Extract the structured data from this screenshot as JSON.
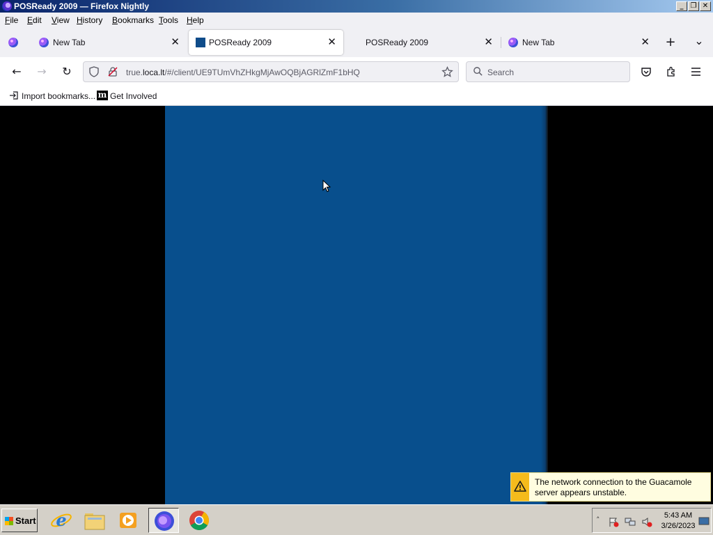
{
  "window": {
    "title": "POSReady 2009 — Firefox Nightly",
    "minimize_glyph": "_",
    "restore_glyph": "❐",
    "close_glyph": "✕"
  },
  "menu": [
    "File",
    "Edit",
    "View",
    "History",
    "Bookmarks",
    "Tools",
    "Help"
  ],
  "menu_mnemonics": [
    "F",
    "E",
    "V",
    "H",
    "B",
    "T",
    "H"
  ],
  "tabs": [
    {
      "label": "New Tab",
      "icon": "firefox-icon",
      "active": false
    },
    {
      "label": "POSReady 2009",
      "icon": "posready-favicon",
      "active": true
    },
    {
      "label": "POSReady 2009",
      "icon": "none",
      "active": false
    },
    {
      "label": "New Tab",
      "icon": "firefox-icon",
      "active": false
    }
  ],
  "tab_close_glyph": "✕",
  "toolbar": {
    "new_tab_glyph": "+",
    "tab_list_glyph": "⌄",
    "back_glyph": "←",
    "forward_glyph": "→",
    "reload_glyph": "↻"
  },
  "urlbar": {
    "prefix": "true.",
    "host": "loca.lt",
    "path": "/#/client/UE9TUmVhZHkgMjAwOQBjAGRlZmF1bHQ"
  },
  "search": {
    "placeholder": "Search"
  },
  "bookmarks": [
    {
      "label": "Import bookmarks...",
      "icon": "import-icon"
    },
    {
      "label": "Get Involved",
      "icon": "m-logo-icon"
    }
  ],
  "notification": {
    "message": "The network connection to the Guacamole server appears unstable."
  },
  "taskbar": {
    "start_label": "Start",
    "apps": [
      "internet-explorer-icon",
      "file-explorer-icon",
      "media-player-icon",
      "firefox-icon",
      "chrome-icon"
    ]
  },
  "clock": {
    "time": "5:43 AM",
    "date": "3/26/2023"
  },
  "colors": {
    "remote_desktop": "#084f8d",
    "title_gradient_start": "#0a246a",
    "warning": "#f5bb1c"
  }
}
